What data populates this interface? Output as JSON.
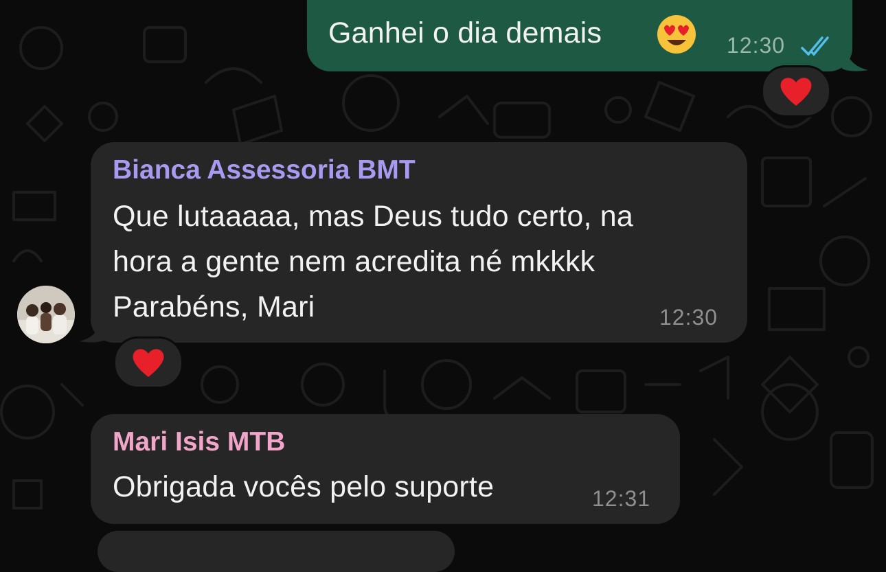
{
  "messages": {
    "outgoing": {
      "text": "Ganhei o dia demais",
      "time": "12:30",
      "reaction": "heart"
    },
    "bianca": {
      "sender": "Bianca Assessoria BMT",
      "text": "Que lutaaaaa, mas Deus tudo certo, na\nhora a gente nem acredita né mkkkk\nParabéns, Mari",
      "time": "12:30",
      "reaction": "heart"
    },
    "mari": {
      "sender": "Mari Isis MTB",
      "text": "Obrigada vocês pelo suporte",
      "time": "12:31"
    }
  },
  "colors": {
    "outgoing_bubble": "#1e5a43",
    "incoming_bubble": "#262626",
    "sender_bianca": "#a89af0",
    "sender_mari": "#f0a5c9",
    "read_ticks": "#53bdeb",
    "reaction_heart": "#e8202a"
  },
  "icons": [
    "smiling-face-with-heart-eyes-emoji",
    "double-check-icon",
    "heart-reaction-icon"
  ]
}
